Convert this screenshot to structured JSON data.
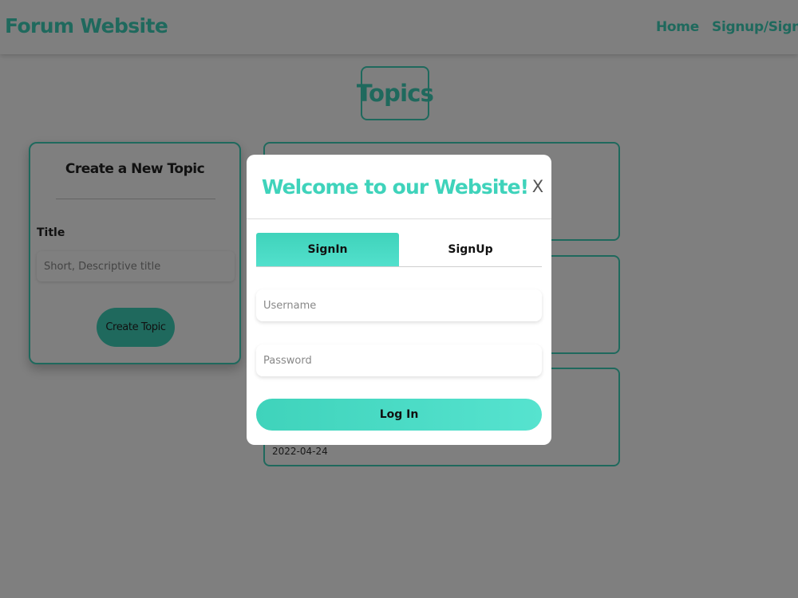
{
  "navbar": {
    "brand": "Forum Website",
    "links": [
      {
        "label": "Home"
      },
      {
        "label": "Signup/Signin"
      }
    ]
  },
  "page": {
    "heading": "Topics"
  },
  "create_topic": {
    "title": "Create a New Topic",
    "title_label": "Title",
    "title_placeholder": "Short, Descriptive title",
    "button_label": "Create Topic"
  },
  "topics": [
    {
      "date": ""
    },
    {
      "date": ""
    },
    {
      "date": "2022-04-24"
    }
  ],
  "modal": {
    "title": "Welcome to our Website!",
    "close_label": "X",
    "tabs": [
      {
        "label": "SignIn",
        "active": true
      },
      {
        "label": "SignUp",
        "active": false
      }
    ],
    "username_placeholder": "Username",
    "password_placeholder": "Password",
    "login_label": "Log In"
  },
  "colors": {
    "accent": "#3fd3bb",
    "overlay": "rgba(0,0,0,0.5)"
  }
}
